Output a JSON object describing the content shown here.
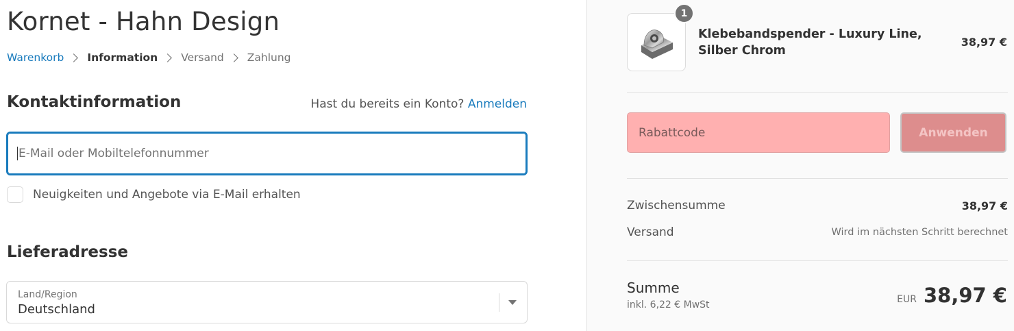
{
  "shop": {
    "title": "Kornet - Hahn Design"
  },
  "breadcrumb": {
    "cart": "Warenkorb",
    "information": "Information",
    "shipping": "Versand",
    "payment": "Zahlung"
  },
  "contact": {
    "title": "Kontaktinformation",
    "login_prompt": "Hast du bereits ein Konto?",
    "login_link": "Anmelden",
    "email_placeholder": "E-Mail oder Mobiltelefonnummer",
    "email_value": "",
    "newsletter_label": "Neuigkeiten und Angebote via E-Mail erhalten",
    "newsletter_checked": false
  },
  "shipping_address": {
    "title": "Lieferadresse",
    "country_label": "Land/Region",
    "country_value": "Deutschland"
  },
  "order_summary": {
    "product": {
      "quantity": "1",
      "name": "Klebebandspender - Luxury Line, Silber Chrom",
      "price": "38,97 €",
      "image_icon": "tape-dispenser-icon"
    },
    "discount": {
      "placeholder": "Rabattcode",
      "value": "",
      "apply_label": "Anwenden"
    },
    "subtotal": {
      "label": "Zwischensumme",
      "value": "38,97 €"
    },
    "shipping": {
      "label": "Versand",
      "value": "Wird im nächsten Schritt berechnet"
    },
    "total": {
      "label": "Summe",
      "tax_note": "inkl. 6,22 € MwSt",
      "currency": "EUR",
      "amount": "38,97 €"
    }
  },
  "colors": {
    "link": "#197bbd",
    "discount_field": "#ffb0b0",
    "apply_button": "#dd8d8d",
    "sidebar_bg": "#fafafa"
  }
}
